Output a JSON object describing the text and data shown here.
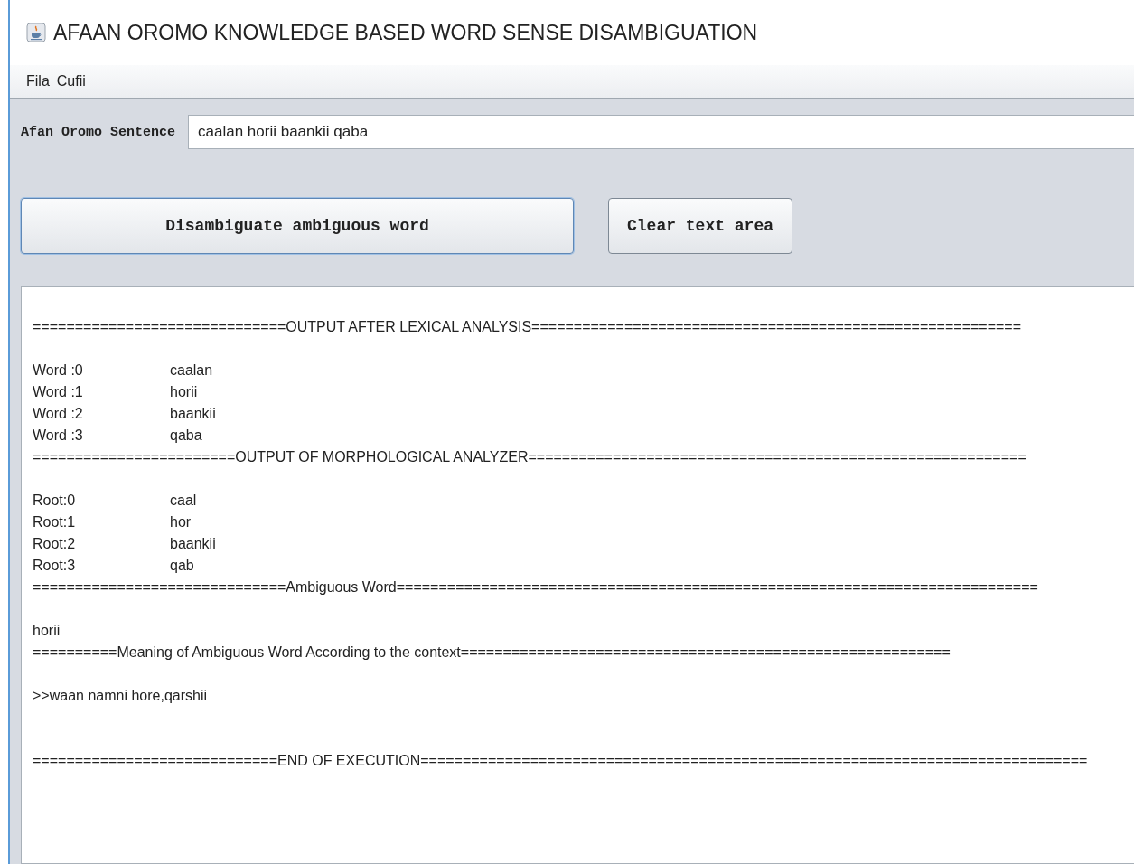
{
  "window": {
    "title": "AFAAN OROMO KNOWLEDGE BASED WORD SENSE DISAMBIGUATION"
  },
  "menu": [
    "Fila",
    "Cufii"
  ],
  "sentence": {
    "label": "Afan Oromo Sentence",
    "value": "caalan horii baankii qaba"
  },
  "buttons": [
    {
      "label": "Disambiguate ambiguous word"
    },
    {
      "label": "Clear text area"
    }
  ],
  "output": [
    {
      "kind": "blank"
    },
    {
      "kind": "separator",
      "text": "==============================OUTPUT AFTER LEXICAL ANALYSIS=========================================================="
    },
    {
      "kind": "blank"
    },
    {
      "kind": "pair",
      "key": "Word :0",
      "value": "caalan"
    },
    {
      "kind": "pair",
      "key": "Word :1",
      "value": "horii"
    },
    {
      "kind": "pair",
      "key": "Word :2",
      "value": "baankii"
    },
    {
      "kind": "pair",
      "key": "Word :3",
      "value": "qaba"
    },
    {
      "kind": "separator",
      "text": "========================OUTPUT OF MORPHOLOGICAL ANALYZER==========================================================="
    },
    {
      "kind": "blank"
    },
    {
      "kind": "pair",
      "key": "Root:0",
      "value": "caal"
    },
    {
      "kind": "pair",
      "key": "Root:1",
      "value": "hor"
    },
    {
      "kind": "pair",
      "key": "Root:2",
      "value": "baankii"
    },
    {
      "kind": "pair",
      "key": "Root:3",
      "value": "qab"
    },
    {
      "kind": "separator",
      "text": "==============================Ambiguous Word============================================================================"
    },
    {
      "kind": "blank"
    },
    {
      "kind": "text",
      "text": "horii"
    },
    {
      "kind": "separator",
      "text": "==========Meaning of Ambiguous Word According to the context=========================================================="
    },
    {
      "kind": "blank"
    },
    {
      "kind": "text",
      "text": ">>waan namni hore,qarshii"
    },
    {
      "kind": "blank"
    },
    {
      "kind": "blank"
    },
    {
      "kind": "separator",
      "text": "=============================END OF EXECUTION==============================================================================="
    }
  ]
}
